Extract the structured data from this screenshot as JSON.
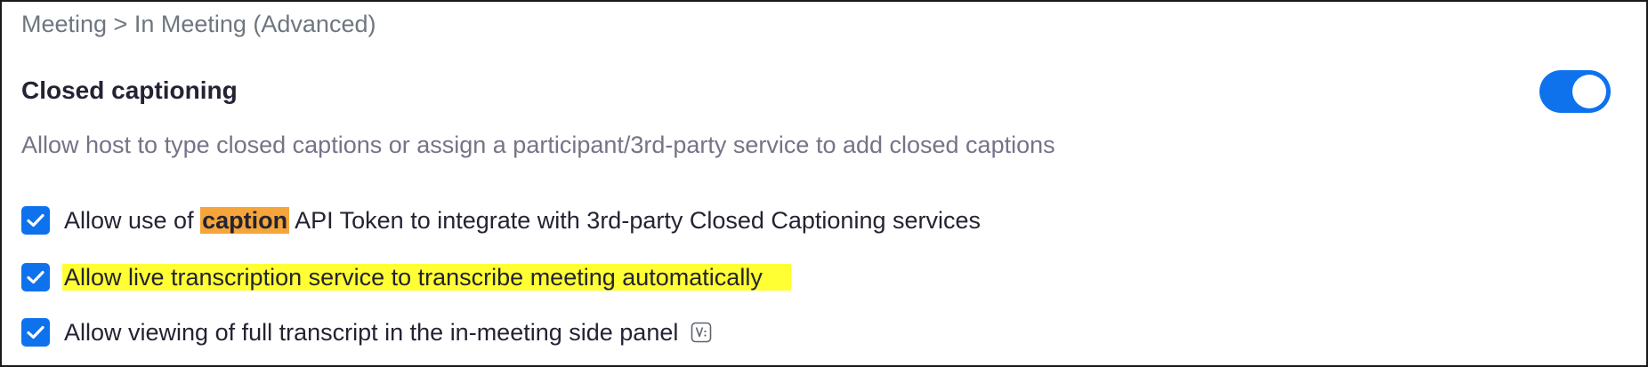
{
  "breadcrumb": "Meeting > In Meeting (Advanced)",
  "setting": {
    "title": "Closed captioning",
    "description": "Allow host to type closed captions or assign a participant/3rd-party service to add closed captions",
    "toggle_on": true
  },
  "options": [
    {
      "prefix": "Allow use of ",
      "highlight": "caption",
      "suffix": " API Token to integrate with 3rd-party Closed Captioning services",
      "checked": true
    },
    {
      "label": "Allow live transcription service to transcribe meeting automatically",
      "checked": true
    },
    {
      "label": "Allow viewing of full transcript in the in-meeting side panel",
      "checked": true,
      "badge_icon": "version-badge-icon"
    }
  ],
  "colors": {
    "accent": "#0e72ed",
    "highlight_orange": "#f5a53a",
    "highlight_yellow": "#ffff33"
  }
}
